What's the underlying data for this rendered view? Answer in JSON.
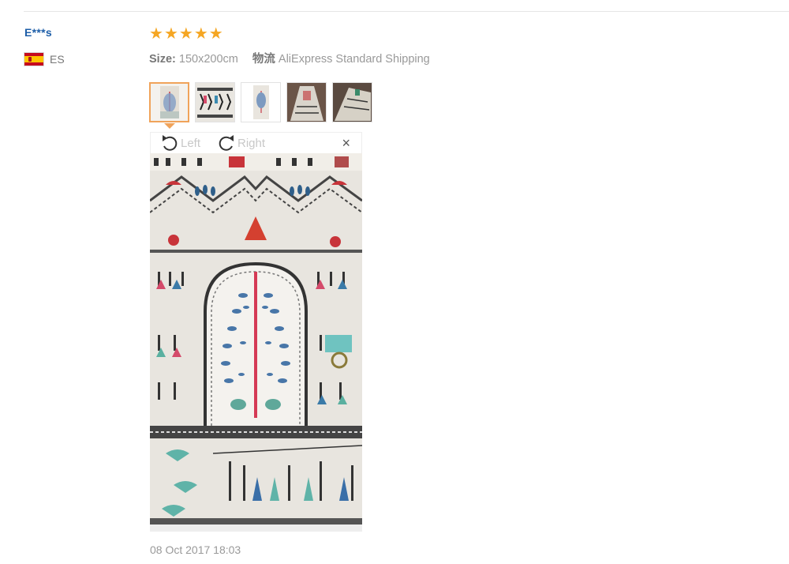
{
  "reviewer": {
    "name": "E***s",
    "country_code": "ES",
    "flag_icon": "spain-flag-icon"
  },
  "review": {
    "rating": 5,
    "rating_max": 5,
    "star_color": "#f5a623",
    "size_label": "Size:",
    "size_value": "150x200cm",
    "logistics_label": "物流",
    "logistics_value": "AliExpress Standard Shipping",
    "photo_count": 5,
    "active_photo_index": 0,
    "date": "08 Oct 2017 18:03"
  },
  "viewer": {
    "rotate_left_label": "Left",
    "rotate_right_label": "Right",
    "close_symbol": "×",
    "rotate_left_icon": "rotate-left-icon",
    "rotate_right_icon": "rotate-right-icon",
    "close_icon": "close-icon"
  },
  "colors": {
    "username": "#1d5ea8",
    "accent_border": "#f0a35a",
    "muted_text": "#999999"
  }
}
